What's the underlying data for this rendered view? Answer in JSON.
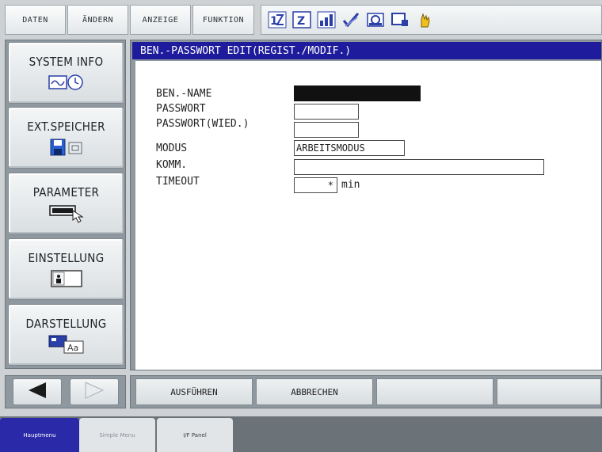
{
  "menubar": {
    "tabs": [
      "DATEN",
      "ÄNDERN",
      "ANZEIGE",
      "FUNKTION"
    ],
    "status_icons": [
      "tool-number-icon",
      "edit-mode-icon",
      "signal-level-icon",
      "check-icon",
      "camera-icon",
      "screen-icon",
      "hand-servo-icon"
    ],
    "status_icon_text": {
      "edit_mode": "Z"
    }
  },
  "sidemenu": {
    "items": [
      {
        "label": "SYSTEM INFO",
        "icon": "system-info-icon"
      },
      {
        "label": "EXT.SPEICHER",
        "icon": "external-memory-icon"
      },
      {
        "label": "PARAMETER",
        "icon": "parameter-icon"
      },
      {
        "label": "EINSTELLUNG",
        "icon": "settings-icon"
      },
      {
        "label": "DARSTELLUNG",
        "icon": "display-icon"
      }
    ],
    "icon_text": {
      "display": "Aa"
    }
  },
  "nav": {
    "back_icon": "arrow-left-icon",
    "forward_icon": "arrow-right-icon"
  },
  "main": {
    "title": "BEN.-PASSWORT EDIT(REGIST./MODIF.)",
    "fields": [
      {
        "label": "BEN.-NAME",
        "value": ""
      },
      {
        "label": "PASSWORT",
        "value": ""
      },
      {
        "label": "PASSWORT(WIED.)",
        "value": ""
      },
      {
        "label": "MODUS",
        "value": "ARBEITSMODUS"
      },
      {
        "label": "KOMM.",
        "value": ""
      },
      {
        "label": "TIMEOUT",
        "value": "*",
        "unit": "min"
      }
    ]
  },
  "funcbar": {
    "buttons": [
      "AUSFÜHREN",
      "ABBRECHEN",
      "",
      ""
    ]
  },
  "tabs": {
    "items": [
      "Hauptmenu",
      "Simple Menu",
      "I/F Panel"
    ]
  },
  "colors": {
    "title_bar": "#1e1c9c",
    "active_tab": "#2a2aa8",
    "frame_gray": "#8e989e"
  }
}
